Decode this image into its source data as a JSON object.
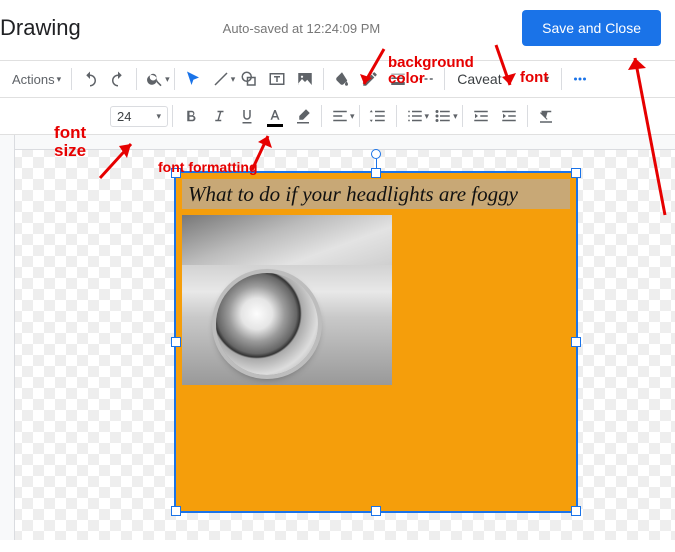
{
  "header": {
    "title": "Drawing",
    "autosave": "Auto-saved at 12:24:09 PM",
    "save_btn": "Save and Close"
  },
  "toolbar": {
    "actions": "Actions",
    "font_name": "Caveat",
    "font_size": "24"
  },
  "canvas": {
    "text": "What to do if your headlights are foggy"
  },
  "annotations": {
    "bg_color": "background\ncolor",
    "font": "font",
    "font_size": "font\nsize",
    "font_formatting": "font formatting"
  }
}
